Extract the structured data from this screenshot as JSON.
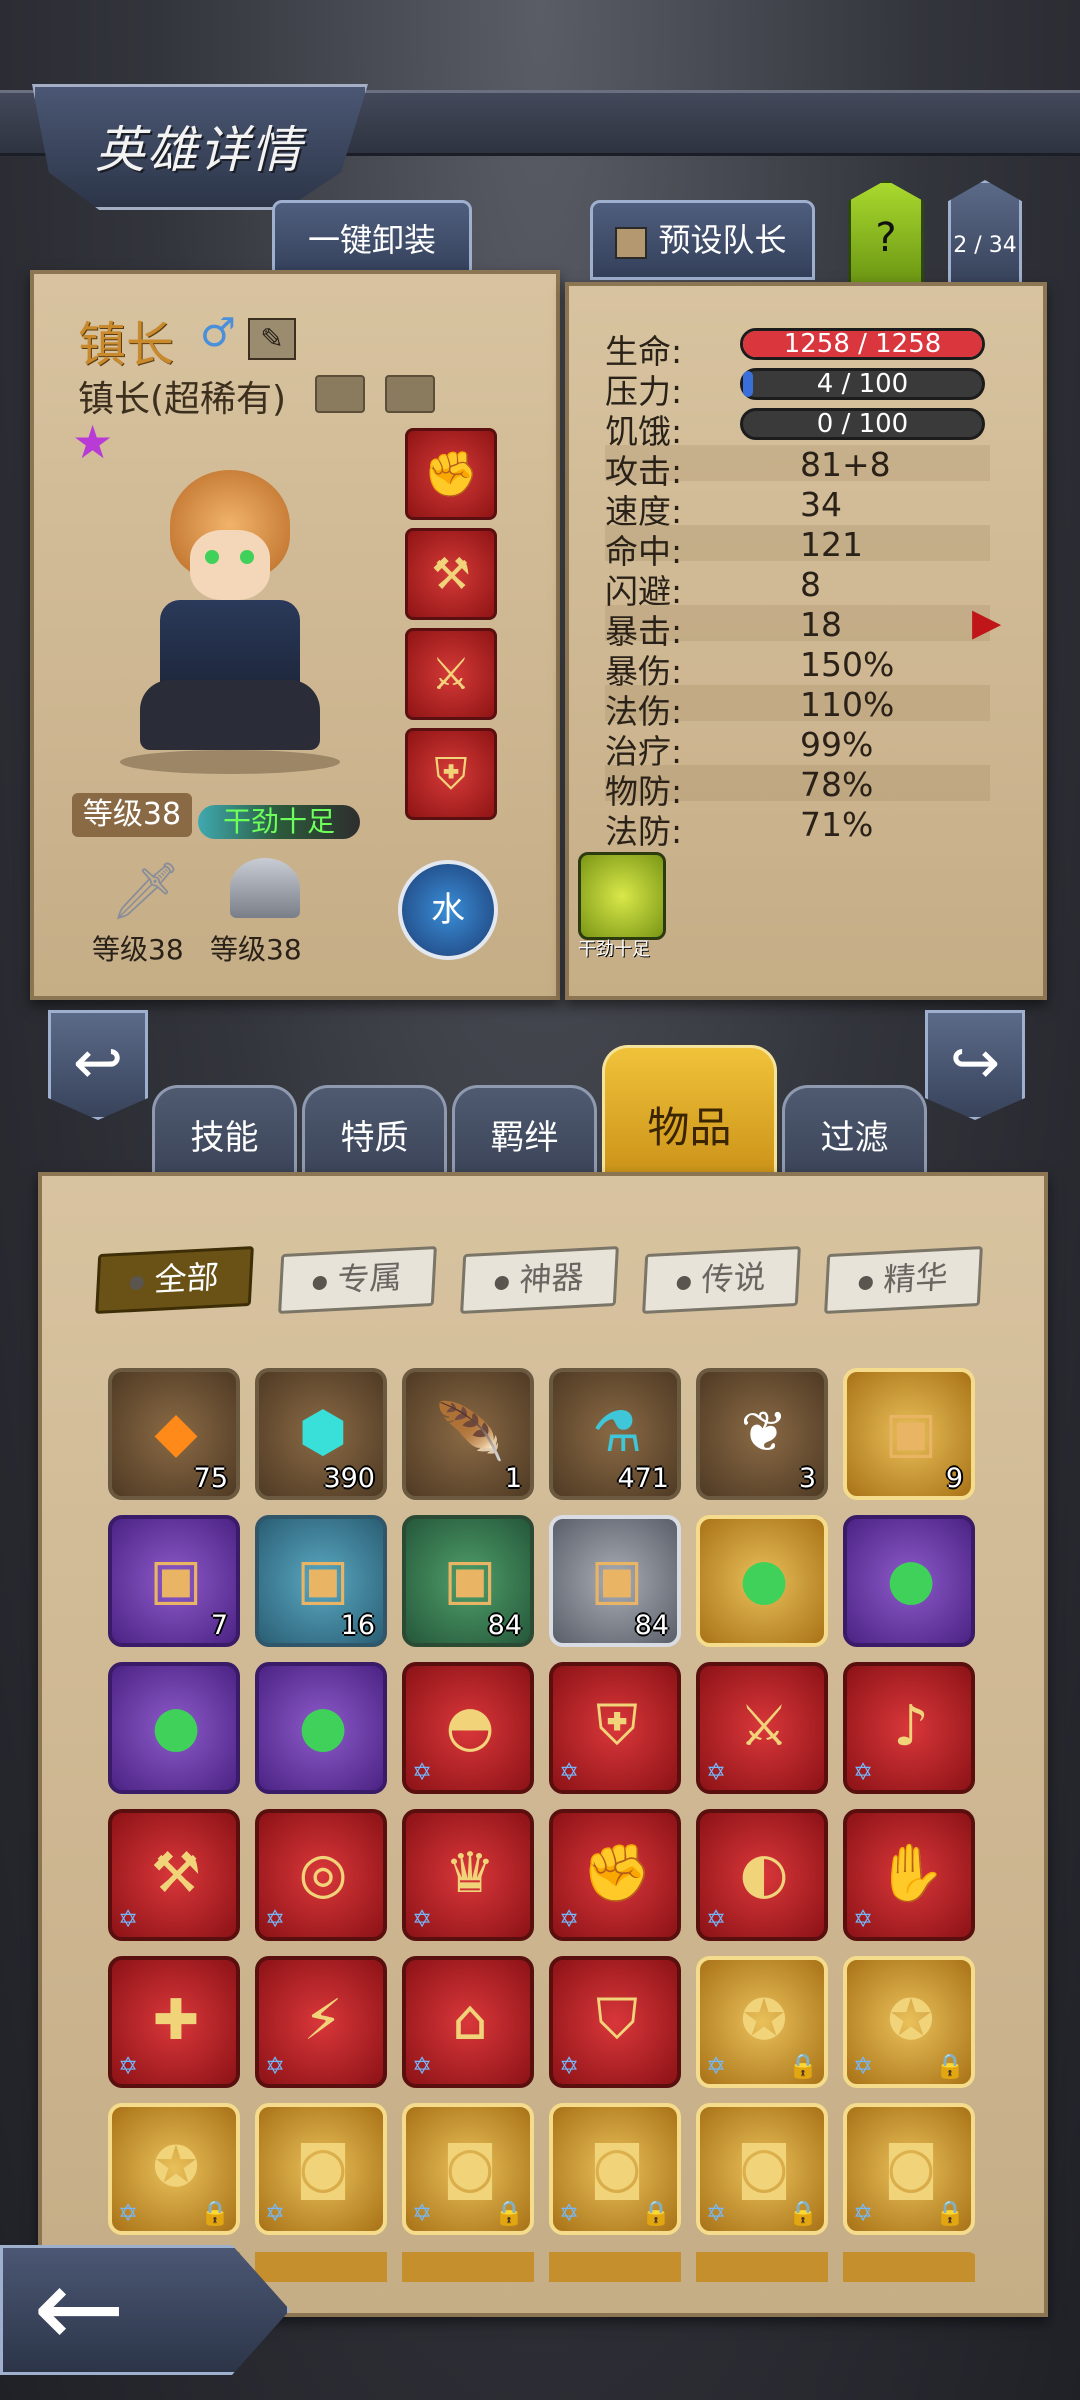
{
  "header": {
    "title": "英雄详情"
  },
  "top_buttons": {
    "unequip_all": "一键卸装",
    "preset_leader": "预设队长",
    "help": "?",
    "page_counter": "2 / 34"
  },
  "hero": {
    "name": "镇长",
    "subtitle": "镇长(超稀有)",
    "level_label": "等级38",
    "status_tag": "干劲十足",
    "weapon_level": "等级38",
    "armor_level": "等级38",
    "element": "水",
    "trait_label": "干劲十足",
    "gender_icon": "male-icon"
  },
  "stats": {
    "hp": {
      "label": "生命:",
      "value": "1258 / 1258",
      "fraction": 1.0,
      "color": "#d9363e"
    },
    "stress": {
      "label": "压力:",
      "value": "4 / 100",
      "fraction": 0.04,
      "color": "#3a6ed8"
    },
    "hunger": {
      "label": "饥饿:",
      "value": "0 / 100",
      "fraction": 0.0,
      "color": "#3a3a3a"
    },
    "rows": [
      {
        "label": "攻击:",
        "value": "81+8"
      },
      {
        "label": "速度:",
        "value": "34"
      },
      {
        "label": "命中:",
        "value": "121"
      },
      {
        "label": "闪避:",
        "value": "8"
      },
      {
        "label": "暴击:",
        "value": "18"
      },
      {
        "label": "暴伤:",
        "value": "150%"
      },
      {
        "label": "法伤:",
        "value": "110%"
      },
      {
        "label": "治疗:",
        "value": "99%"
      },
      {
        "label": "物防:",
        "value": "78%"
      },
      {
        "label": "法防:",
        "value": "71%"
      }
    ]
  },
  "category_tabs": [
    {
      "label": "技能",
      "active": false
    },
    {
      "label": "特质",
      "active": false
    },
    {
      "label": "羁绊",
      "active": false
    },
    {
      "label": "物品",
      "active": true
    },
    {
      "label": "过滤",
      "active": false
    }
  ],
  "filters": [
    {
      "label": "全部",
      "active": true
    },
    {
      "label": "专属",
      "active": false
    },
    {
      "label": "神器",
      "active": false
    },
    {
      "label": "传说",
      "active": false
    },
    {
      "label": "精华",
      "active": false
    }
  ],
  "items": [
    {
      "icon": "amber-gem-icon",
      "quality": "brown",
      "count": "75"
    },
    {
      "icon": "teal-rune-icon",
      "quality": "brown",
      "count": "390"
    },
    {
      "icon": "phoenix-feather-icon",
      "quality": "brown",
      "count": "1"
    },
    {
      "icon": "potion-flask-icon",
      "quality": "brown",
      "count": "471"
    },
    {
      "icon": "white-feather-icon",
      "quality": "brown",
      "count": "3"
    },
    {
      "icon": "treasure-chest-icon",
      "quality": "gold",
      "count": "9"
    },
    {
      "icon": "treasure-chest-icon",
      "quality": "purple",
      "count": "7"
    },
    {
      "icon": "treasure-chest-icon",
      "quality": "teal",
      "count": "16"
    },
    {
      "icon": "treasure-chest-icon",
      "quality": "green",
      "count": "84"
    },
    {
      "icon": "treasure-chest-icon",
      "quality": "gray",
      "count": "84"
    },
    {
      "icon": "green-orb-icon",
      "quality": "gold",
      "count": ""
    },
    {
      "icon": "green-orb-icon",
      "quality": "purple",
      "count": ""
    },
    {
      "icon": "green-orb-icon",
      "quality": "purple",
      "count": ""
    },
    {
      "icon": "green-orb-icon",
      "quality": "purple",
      "count": ""
    },
    {
      "icon": "hood-icon",
      "quality": "red",
      "count": ""
    },
    {
      "icon": "shield-crest-icon",
      "quality": "red",
      "count": ""
    },
    {
      "icon": "curved-dagger-icon",
      "quality": "red",
      "count": ""
    },
    {
      "icon": "horn-icon",
      "quality": "red",
      "count": ""
    },
    {
      "icon": "battle-axe-icon",
      "quality": "red",
      "count": ""
    },
    {
      "icon": "gem-ring-icon",
      "quality": "red",
      "count": ""
    },
    {
      "icon": "crown-icon",
      "quality": "red",
      "count": ""
    },
    {
      "icon": "gauntlet-icon",
      "quality": "red",
      "count": ""
    },
    {
      "icon": "red-belt-icon",
      "quality": "red",
      "count": ""
    },
    {
      "icon": "armored-glove-icon",
      "quality": "red",
      "count": ""
    },
    {
      "icon": "cross-staff-icon",
      "quality": "red",
      "count": ""
    },
    {
      "icon": "lightning-spear-icon",
      "quality": "red",
      "count": ""
    },
    {
      "icon": "lantern-icon",
      "quality": "red",
      "count": ""
    },
    {
      "icon": "cloak-icon",
      "quality": "red",
      "count": ""
    },
    {
      "icon": "winged-amulet-icon",
      "quality": "gold",
      "count": ""
    },
    {
      "icon": "winged-amulet-icon",
      "quality": "gold",
      "count": ""
    },
    {
      "icon": "winged-amulet-icon",
      "quality": "gold",
      "count": ""
    },
    {
      "icon": "leather-pack-icon",
      "quality": "gold",
      "count": ""
    },
    {
      "icon": "leather-pack-icon",
      "quality": "gold",
      "count": ""
    },
    {
      "icon": "leather-pack-icon",
      "quality": "gold",
      "count": ""
    },
    {
      "icon": "leather-pack-icon",
      "quality": "gold",
      "count": ""
    },
    {
      "icon": "leather-pack-icon",
      "quality": "gold",
      "count": ""
    }
  ]
}
